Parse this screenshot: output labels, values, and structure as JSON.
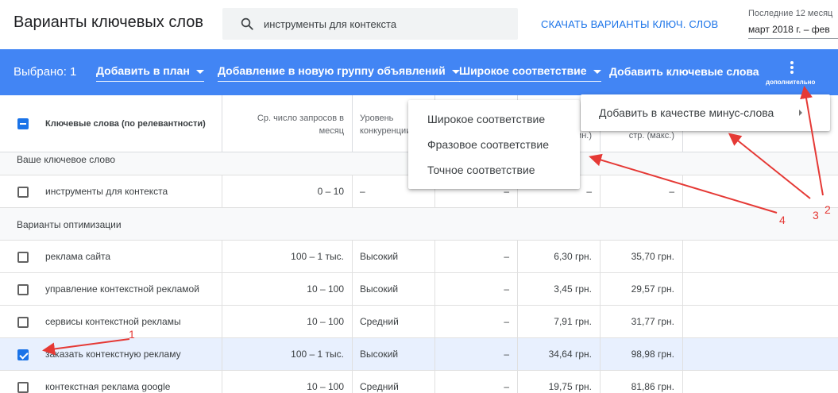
{
  "header": {
    "title": "Варианты ключевых слов",
    "search_value": "инструменты для контекста",
    "download_label": "СКАЧАТЬ ВАРИАНТЫ КЛЮЧ. СЛОВ",
    "date_caption": "Последние 12 месяц",
    "date_range": "март 2018 г. – фев"
  },
  "toolbar": {
    "selected": "Выбрано: 1",
    "add_to_plan": "Добавить в план",
    "add_to_new_group": "Добавление в новую группу объявлений",
    "match_type": "Широкое соответствие",
    "add_keywords": "Добавить ключевые слова",
    "more": "дополнительно"
  },
  "columns": {
    "keyword": "Ключевые слова (по релевантности)",
    "avg_searches": "Ср. число запросов в месяц",
    "competition": "Уровень конкуренции",
    "bid_low_partial": "ин.)",
    "bid_high": "стр. (макс.)"
  },
  "groups": {
    "your_keyword": "Ваше ключевое слово",
    "suggestions": "Варианты оптимизации"
  },
  "rows": [
    {
      "keyword": "инструменты для контекста",
      "searches": "0 – 10",
      "competition": "–",
      "impr_share": "–",
      "bid_low": "–",
      "bid_high": "–",
      "checked": false
    },
    {
      "keyword": "реклама сайта",
      "searches": "100 – 1 тыс.",
      "competition": "Высокий",
      "impr_share": "–",
      "bid_low": "6,30 грн.",
      "bid_high": "35,70 грн.",
      "checked": false
    },
    {
      "keyword": "управление контекстной рекламой",
      "searches": "10 – 100",
      "competition": "Высокий",
      "impr_share": "–",
      "bid_low": "3,45 грн.",
      "bid_high": "29,57 грн.",
      "checked": false
    },
    {
      "keyword": "сервисы контекстной рекламы",
      "searches": "10 – 100",
      "competition": "Средний",
      "impr_share": "–",
      "bid_low": "7,91 грн.",
      "bid_high": "31,77 грн.",
      "checked": false
    },
    {
      "keyword": "заказать контекстную рекламу",
      "searches": "100 – 1 тыс.",
      "competition": "Высокий",
      "impr_share": "–",
      "bid_low": "34,64 грн.",
      "bid_high": "98,98 грн.",
      "checked": true
    },
    {
      "keyword": "контекстная реклама google",
      "searches": "10 – 100",
      "competition": "Средний",
      "impr_share": "–",
      "bid_low": "19,75 грн.",
      "bid_high": "81,86 грн.",
      "checked": false
    }
  ],
  "match_menu": {
    "items": [
      "Широкое соответствие",
      "Фразовое соответствие",
      "Точное соответствие"
    ]
  },
  "more_menu": {
    "item": "Добавить в качестве минус-слова"
  },
  "annotations": [
    "1",
    "2",
    "3",
    "4"
  ],
  "colors": {
    "toolbar": "#4285f4",
    "accent": "#1a73e8",
    "annotation": "#e53935"
  }
}
